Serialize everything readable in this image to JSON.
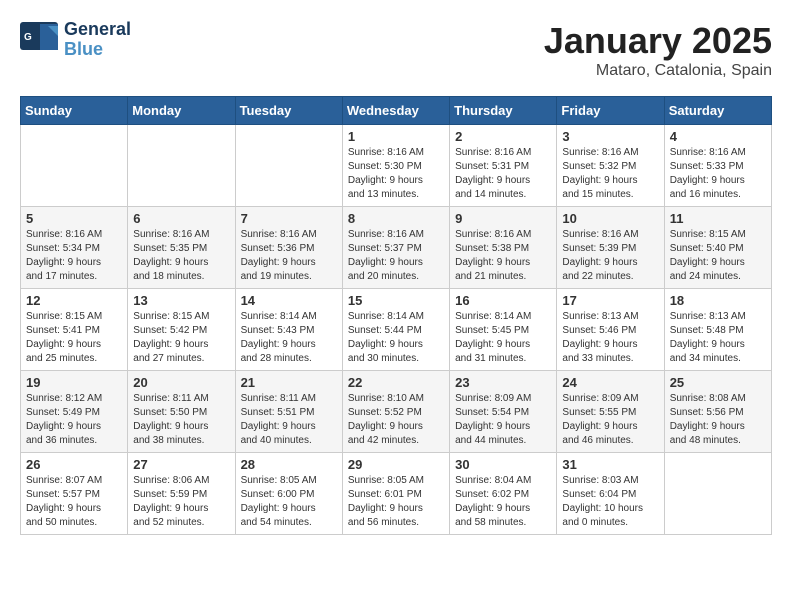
{
  "header": {
    "logo_line1": "General",
    "logo_line2": "Blue",
    "month": "January 2025",
    "location": "Mataro, Catalonia, Spain"
  },
  "weekdays": [
    "Sunday",
    "Monday",
    "Tuesday",
    "Wednesday",
    "Thursday",
    "Friday",
    "Saturday"
  ],
  "weeks": [
    [
      {
        "day": "",
        "info": ""
      },
      {
        "day": "",
        "info": ""
      },
      {
        "day": "",
        "info": ""
      },
      {
        "day": "1",
        "info": "Sunrise: 8:16 AM\nSunset: 5:30 PM\nDaylight: 9 hours\nand 13 minutes."
      },
      {
        "day": "2",
        "info": "Sunrise: 8:16 AM\nSunset: 5:31 PM\nDaylight: 9 hours\nand 14 minutes."
      },
      {
        "day": "3",
        "info": "Sunrise: 8:16 AM\nSunset: 5:32 PM\nDaylight: 9 hours\nand 15 minutes."
      },
      {
        "day": "4",
        "info": "Sunrise: 8:16 AM\nSunset: 5:33 PM\nDaylight: 9 hours\nand 16 minutes."
      }
    ],
    [
      {
        "day": "5",
        "info": "Sunrise: 8:16 AM\nSunset: 5:34 PM\nDaylight: 9 hours\nand 17 minutes."
      },
      {
        "day": "6",
        "info": "Sunrise: 8:16 AM\nSunset: 5:35 PM\nDaylight: 9 hours\nand 18 minutes."
      },
      {
        "day": "7",
        "info": "Sunrise: 8:16 AM\nSunset: 5:36 PM\nDaylight: 9 hours\nand 19 minutes."
      },
      {
        "day": "8",
        "info": "Sunrise: 8:16 AM\nSunset: 5:37 PM\nDaylight: 9 hours\nand 20 minutes."
      },
      {
        "day": "9",
        "info": "Sunrise: 8:16 AM\nSunset: 5:38 PM\nDaylight: 9 hours\nand 21 minutes."
      },
      {
        "day": "10",
        "info": "Sunrise: 8:16 AM\nSunset: 5:39 PM\nDaylight: 9 hours\nand 22 minutes."
      },
      {
        "day": "11",
        "info": "Sunrise: 8:15 AM\nSunset: 5:40 PM\nDaylight: 9 hours\nand 24 minutes."
      }
    ],
    [
      {
        "day": "12",
        "info": "Sunrise: 8:15 AM\nSunset: 5:41 PM\nDaylight: 9 hours\nand 25 minutes."
      },
      {
        "day": "13",
        "info": "Sunrise: 8:15 AM\nSunset: 5:42 PM\nDaylight: 9 hours\nand 27 minutes."
      },
      {
        "day": "14",
        "info": "Sunrise: 8:14 AM\nSunset: 5:43 PM\nDaylight: 9 hours\nand 28 minutes."
      },
      {
        "day": "15",
        "info": "Sunrise: 8:14 AM\nSunset: 5:44 PM\nDaylight: 9 hours\nand 30 minutes."
      },
      {
        "day": "16",
        "info": "Sunrise: 8:14 AM\nSunset: 5:45 PM\nDaylight: 9 hours\nand 31 minutes."
      },
      {
        "day": "17",
        "info": "Sunrise: 8:13 AM\nSunset: 5:46 PM\nDaylight: 9 hours\nand 33 minutes."
      },
      {
        "day": "18",
        "info": "Sunrise: 8:13 AM\nSunset: 5:48 PM\nDaylight: 9 hours\nand 34 minutes."
      }
    ],
    [
      {
        "day": "19",
        "info": "Sunrise: 8:12 AM\nSunset: 5:49 PM\nDaylight: 9 hours\nand 36 minutes."
      },
      {
        "day": "20",
        "info": "Sunrise: 8:11 AM\nSunset: 5:50 PM\nDaylight: 9 hours\nand 38 minutes."
      },
      {
        "day": "21",
        "info": "Sunrise: 8:11 AM\nSunset: 5:51 PM\nDaylight: 9 hours\nand 40 minutes."
      },
      {
        "day": "22",
        "info": "Sunrise: 8:10 AM\nSunset: 5:52 PM\nDaylight: 9 hours\nand 42 minutes."
      },
      {
        "day": "23",
        "info": "Sunrise: 8:09 AM\nSunset: 5:54 PM\nDaylight: 9 hours\nand 44 minutes."
      },
      {
        "day": "24",
        "info": "Sunrise: 8:09 AM\nSunset: 5:55 PM\nDaylight: 9 hours\nand 46 minutes."
      },
      {
        "day": "25",
        "info": "Sunrise: 8:08 AM\nSunset: 5:56 PM\nDaylight: 9 hours\nand 48 minutes."
      }
    ],
    [
      {
        "day": "26",
        "info": "Sunrise: 8:07 AM\nSunset: 5:57 PM\nDaylight: 9 hours\nand 50 minutes."
      },
      {
        "day": "27",
        "info": "Sunrise: 8:06 AM\nSunset: 5:59 PM\nDaylight: 9 hours\nand 52 minutes."
      },
      {
        "day": "28",
        "info": "Sunrise: 8:05 AM\nSunset: 6:00 PM\nDaylight: 9 hours\nand 54 minutes."
      },
      {
        "day": "29",
        "info": "Sunrise: 8:05 AM\nSunset: 6:01 PM\nDaylight: 9 hours\nand 56 minutes."
      },
      {
        "day": "30",
        "info": "Sunrise: 8:04 AM\nSunset: 6:02 PM\nDaylight: 9 hours\nand 58 minutes."
      },
      {
        "day": "31",
        "info": "Sunrise: 8:03 AM\nSunset: 6:04 PM\nDaylight: 10 hours\nand 0 minutes."
      },
      {
        "day": "",
        "info": ""
      }
    ]
  ]
}
